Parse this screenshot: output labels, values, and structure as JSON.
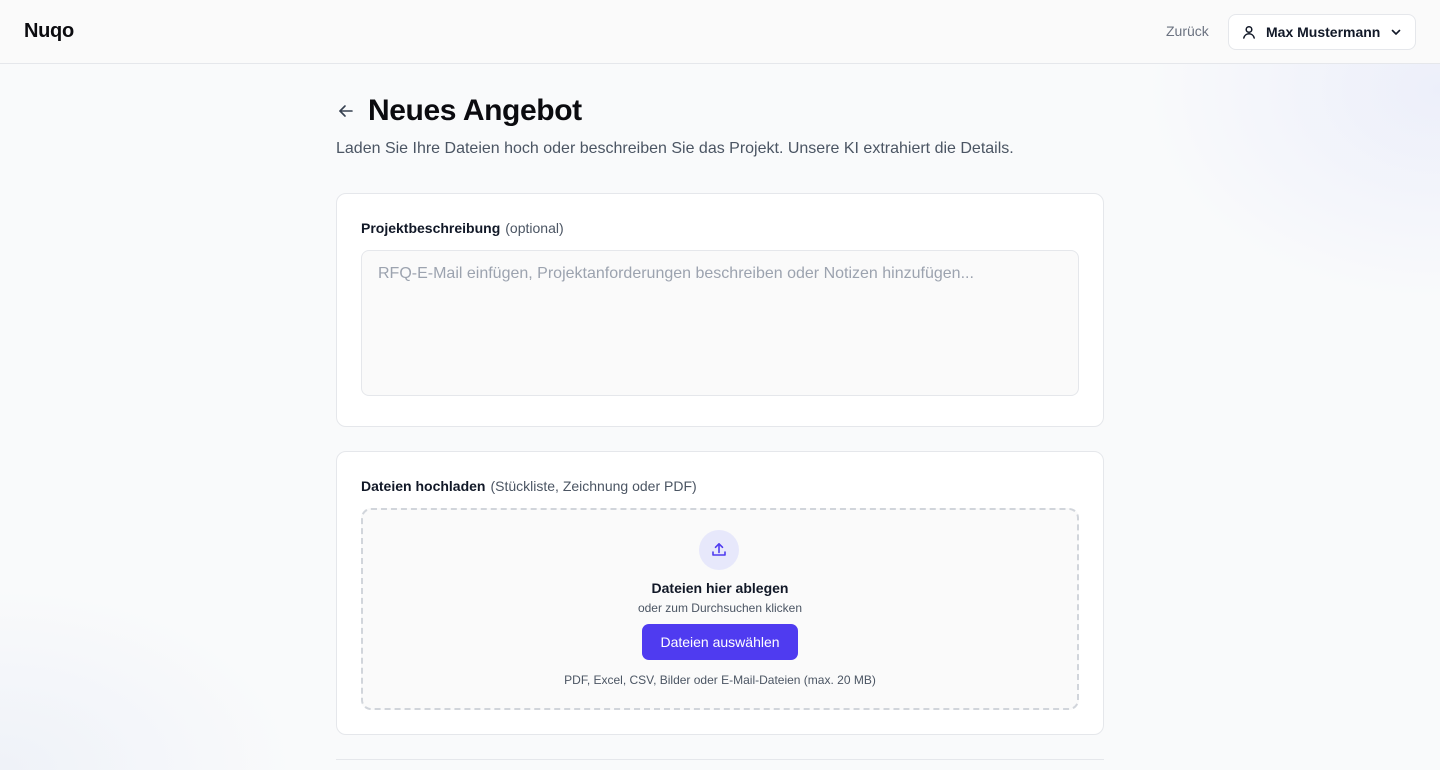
{
  "header": {
    "brand": "Nuqo",
    "back_label": "Zurück",
    "user_name": "Max Mustermann"
  },
  "page": {
    "title": "Neues Angebot",
    "subtitle": "Laden Sie Ihre Dateien hoch oder beschreiben Sie das Projekt. Unsere KI extrahiert die Details."
  },
  "description": {
    "label": "Projektbeschreibung",
    "hint": "(optional)",
    "value": "",
    "placeholder": "RFQ-E-Mail einfügen, Projektanforderungen beschreiben oder Notizen hinzufügen..."
  },
  "upload": {
    "label": "Dateien hochladen",
    "hint": "(Stückliste, Zeichnung oder PDF)",
    "drop_title": "Dateien hier ablegen",
    "drop_subtitle": "oder zum Durchsuchen klicken",
    "button_label": "Dateien auswählen",
    "formats": "PDF, Excel, CSV, Bilder oder E-Mail-Dateien (max. 20 MB)"
  },
  "icons": {
    "user": "user-icon",
    "chevron": "chevron-down-icon",
    "back": "arrow-left-icon",
    "upload": "upload-icon"
  },
  "colors": {
    "accent": "#4f3bf0",
    "upload_icon_bg": "#e7e8fb"
  }
}
